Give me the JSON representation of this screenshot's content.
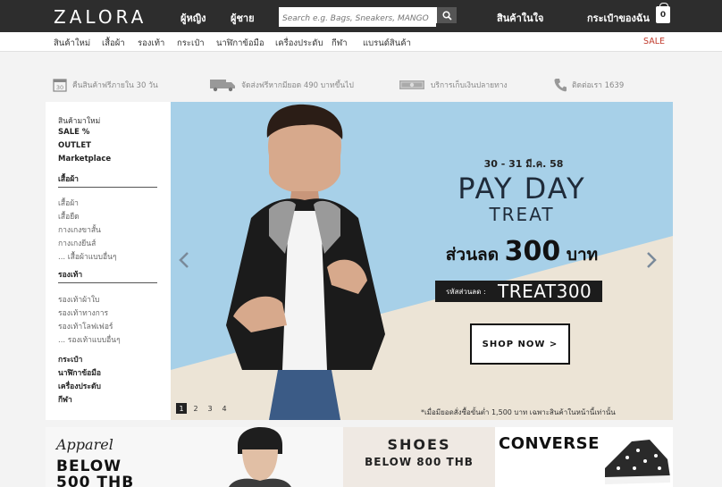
{
  "header": {
    "logo": "ZALORA",
    "nav_women": "ผู้หญิง",
    "nav_men": "ผู้ชาย",
    "search_placeholder": "Search e.g. Bags, Sneakers, MANGO",
    "wishlist": "สินค้าในใจ",
    "bag_label": "กระเป๋าของฉัน",
    "bag_count": "0"
  },
  "categories": [
    "สินค้าใหม่",
    "เสื้อผ้า",
    "รองเท้า",
    "กระเป๋า",
    "นาฬิกาข้อมือ",
    "เครื่องประดับ",
    "กีฬา",
    "แบรนด์สินค้า"
  ],
  "sale_link": "SALE",
  "benefits": [
    {
      "icon": "calendar-30-icon",
      "text": "คืนสินค้าฟรีภายใน 30 วัน"
    },
    {
      "icon": "truck-icon",
      "text": "จัดส่งฟรีหากมียอด 490 บาทขึ้นไป"
    },
    {
      "icon": "cash-icon",
      "text": "บริการเก็บเงินปลายทาง"
    },
    {
      "icon": "phone-icon",
      "text": "ติดต่อเรา 1639"
    }
  ],
  "sidebar": {
    "top": [
      "สินค้ามาใหม่",
      "SALE %",
      "OUTLET",
      "Marketplace"
    ],
    "clothing_title": "เสื้อผ้า",
    "clothing": [
      "เสื้อผ้า",
      "เสื้อยืด",
      "กางเกงขาสั้น",
      "กางเกงยีนส์",
      "... เสื้อผ้าแบบอื่นๆ"
    ],
    "shoes_title": "รองเท้า",
    "shoes": [
      "รองเท้าผ้าใบ",
      "รองเท้าทางการ",
      "รองเท้าโลฟเฟอร์",
      "... รองเท้าแบบอื่นๆ"
    ],
    "bottom": [
      "กระเป๋า",
      "นาฬิกาข้อมือ",
      "เครื่องประดับ",
      "กีฬา"
    ]
  },
  "banner": {
    "date": "30 - 31 มี.ค. 58",
    "title": "PAY DAY",
    "subtitle": "TREAT",
    "discount_pre": "ส่วนลด",
    "discount_amount": "300",
    "discount_post": "บาท",
    "code_label": "รหัสส่วนลด :",
    "code": "TREAT300",
    "cta": "SHOP NOW >",
    "note": "*เมื่อมียอดสั่งซื้อขั้นต่ำ 1,500 บาท เฉพาะสินค้าในหน้านี้เท่านั้น",
    "pages": [
      "1",
      "2",
      "3",
      "4"
    ],
    "active_page": "1"
  },
  "promos": {
    "apparel_title": "Apparel",
    "apparel_line1": "BELOW",
    "apparel_line2": "500 THB",
    "shoes_title": "SHOES",
    "shoes_line": "BELOW 800 THB",
    "brand": "CONVERSE"
  },
  "colors": {
    "topbar": "#2d2d2d",
    "sale": "#c0392b",
    "banner_sky": "#a7d0e8",
    "banner_beige": "#efe7da"
  }
}
